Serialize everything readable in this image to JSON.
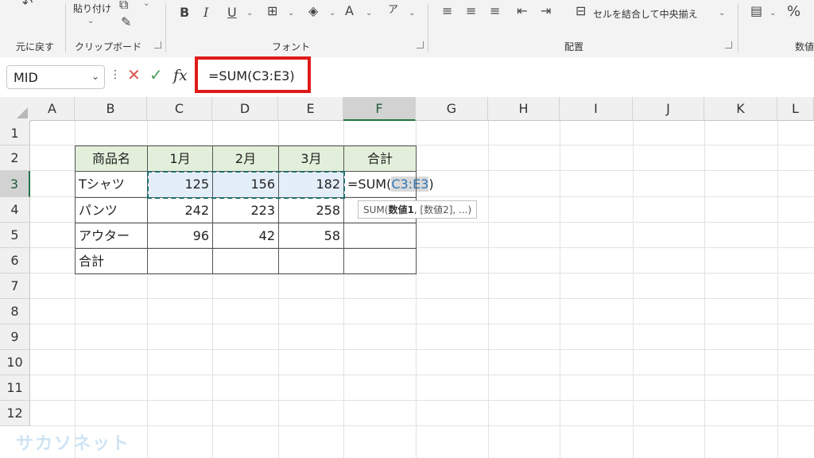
{
  "ribbon": {
    "undo_label": "元に戻す",
    "paste_label": "貼り付け",
    "clipboard_label": "クリップボード",
    "font_group_label": "フォント",
    "alignment_group_label": "配置",
    "merge_center_label": "セルを結合して中央揃え",
    "number_group_label": "数値"
  },
  "formula_bar": {
    "name_box": "MID",
    "formula": "=SUM(C3:E3)"
  },
  "columns": [
    "A",
    "B",
    "C",
    "D",
    "E",
    "F",
    "G",
    "H",
    "I",
    "J",
    "K",
    "L"
  ],
  "rows": [
    "1",
    "2",
    "3",
    "4",
    "5",
    "6",
    "7",
    "8",
    "9",
    "10",
    "11",
    "12"
  ],
  "active_column": "F",
  "active_row": "3",
  "table": {
    "headers": [
      "商品名",
      "1月",
      "2月",
      "3月",
      "合計"
    ],
    "rows": [
      {
        "name": "Tシャツ",
        "m1": "125",
        "m2": "156",
        "m3": "182"
      },
      {
        "name": "パンツ",
        "m1": "242",
        "m2": "223",
        "m3": "258"
      },
      {
        "name": "アウター",
        "m1": "96",
        "m2": "42",
        "m3": "58"
      },
      {
        "name": "合計",
        "m1": "",
        "m2": "",
        "m3": ""
      }
    ],
    "editing_prefix": "=SUM(",
    "editing_ref": "C3:E3",
    "editing_suffix": ")"
  },
  "tooltip": {
    "func": "SUM(",
    "arg1": "数値1",
    "rest": ", [数値2], ...)"
  },
  "watermark": "サカソネット",
  "colors": {
    "header_fill": "#e2efda",
    "selection_fill": "#e3eef9",
    "highlight_border": "#e01a1a",
    "ref_text": "#2e75b6"
  }
}
